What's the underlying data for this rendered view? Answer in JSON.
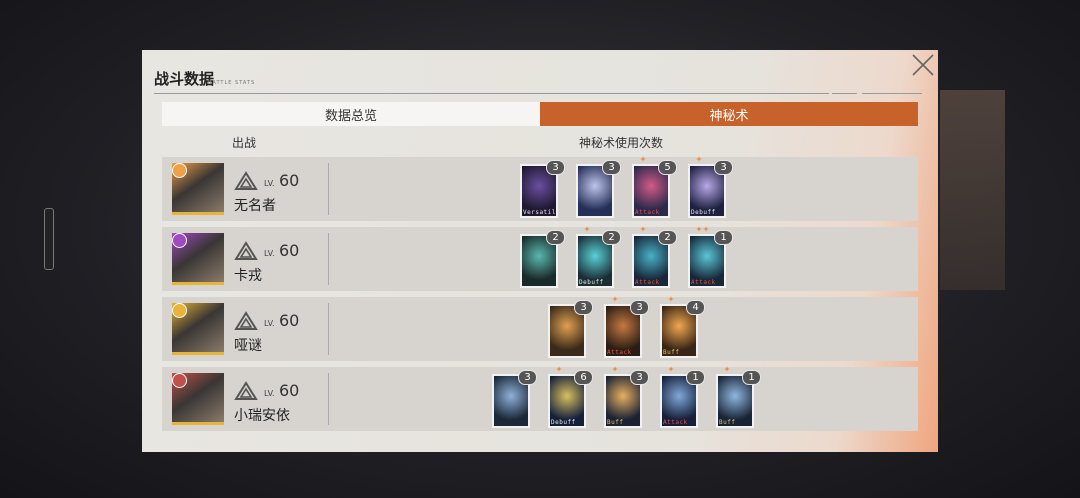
{
  "panel": {
    "title": "战斗数据",
    "subtitle": "BATTLE STATS"
  },
  "tabs": [
    {
      "label": "数据总览"
    },
    {
      "label": "神秘术"
    }
  ],
  "headers": {
    "deployed": "出战",
    "arcanum_usage": "神秘术使用次数"
  },
  "characters": [
    {
      "name": "无名者",
      "lv_label": "LV.",
      "level": "60",
      "badge_color": "#f0a04a",
      "cards": [
        {
          "count": "3",
          "label": "Versatile",
          "colors": [
            "#1e1830",
            "#6b4fa0"
          ],
          "stars": 0
        },
        {
          "count": "3",
          "label": "",
          "colors": [
            "#243058",
            "#c0c4ea"
          ],
          "stars": 0
        },
        {
          "count": "5",
          "label": "Attack",
          "colors": [
            "#2a2a4a",
            "#d45a8a"
          ],
          "stars": 1
        },
        {
          "count": "3",
          "label": "Debuff",
          "colors": [
            "#1e2040",
            "#b8a8e8"
          ],
          "stars": 1
        }
      ]
    },
    {
      "name": "卡戎",
      "lv_label": "LV.",
      "level": "60",
      "badge_color": "#a04ac0",
      "cards": [
        {
          "count": "2",
          "label": "",
          "colors": [
            "#1a2a2a",
            "#5ab8b0"
          ],
          "stars": 0
        },
        {
          "count": "2",
          "label": "Debuff",
          "colors": [
            "#1a2e34",
            "#5ad0d8"
          ],
          "stars": 1
        },
        {
          "count": "2",
          "label": "Attack",
          "colors": [
            "#17283a",
            "#4ab0c8"
          ],
          "stars": 1
        },
        {
          "count": "1",
          "label": "Attack",
          "colors": [
            "#162838",
            "#5cc6d8"
          ],
          "stars": 2
        }
      ]
    },
    {
      "name": "哑谜",
      "lv_label": "LV.",
      "level": "60",
      "badge_color": "#e7b43a",
      "cards": [
        {
          "count": "3",
          "label": "",
          "colors": [
            "#3a2a1a",
            "#e0a050"
          ],
          "stars": 0
        },
        {
          "count": "3",
          "label": "Attack",
          "colors": [
            "#2a1e14",
            "#c87840"
          ],
          "stars": 1
        },
        {
          "count": "4",
          "label": "Buff",
          "colors": [
            "#3a2616",
            "#f0a850"
          ],
          "stars": 1
        }
      ]
    },
    {
      "name": "小瑞安依",
      "lv_label": "LV.",
      "level": "60",
      "badge_color": "#c0504a",
      "cards": [
        {
          "count": "3",
          "label": "",
          "colors": [
            "#1a2838",
            "#90b0d8"
          ],
          "stars": 0
        },
        {
          "count": "6",
          "label": "Debuff",
          "colors": [
            "#14203a",
            "#d8c060"
          ],
          "stars": 1
        },
        {
          "count": "3",
          "label": "Buff",
          "colors": [
            "#1a2234",
            "#e8b060"
          ],
          "stars": 1
        },
        {
          "count": "1",
          "label": "Attack",
          "colors": [
            "#16203a",
            "#80a8d8"
          ],
          "stars": 1
        },
        {
          "count": "1",
          "label": "Buff",
          "colors": [
            "#182436",
            "#90b8e0"
          ],
          "stars": 1
        }
      ]
    }
  ]
}
